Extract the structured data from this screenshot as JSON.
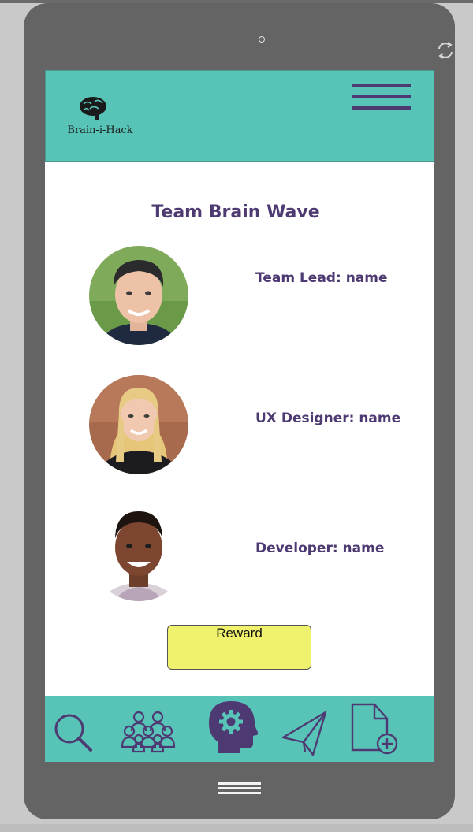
{
  "app": {
    "logo_text": "Brain-i-Hack",
    "accent_color": "#58c4b8",
    "brand_color": "#4e3a72"
  },
  "team": {
    "title": "Team Brain Wave",
    "members": [
      {
        "role": "Team Lead: name"
      },
      {
        "role": "UX Designer: name"
      },
      {
        "role": "Developer: name"
      }
    ]
  },
  "reward_button": {
    "label": "Reward",
    "color": "#f0f26d"
  },
  "nav": {
    "items": [
      {
        "icon": "search-icon"
      },
      {
        "icon": "team-icon"
      },
      {
        "icon": "brain-settings-icon"
      },
      {
        "icon": "send-icon"
      },
      {
        "icon": "new-document-icon"
      }
    ]
  }
}
